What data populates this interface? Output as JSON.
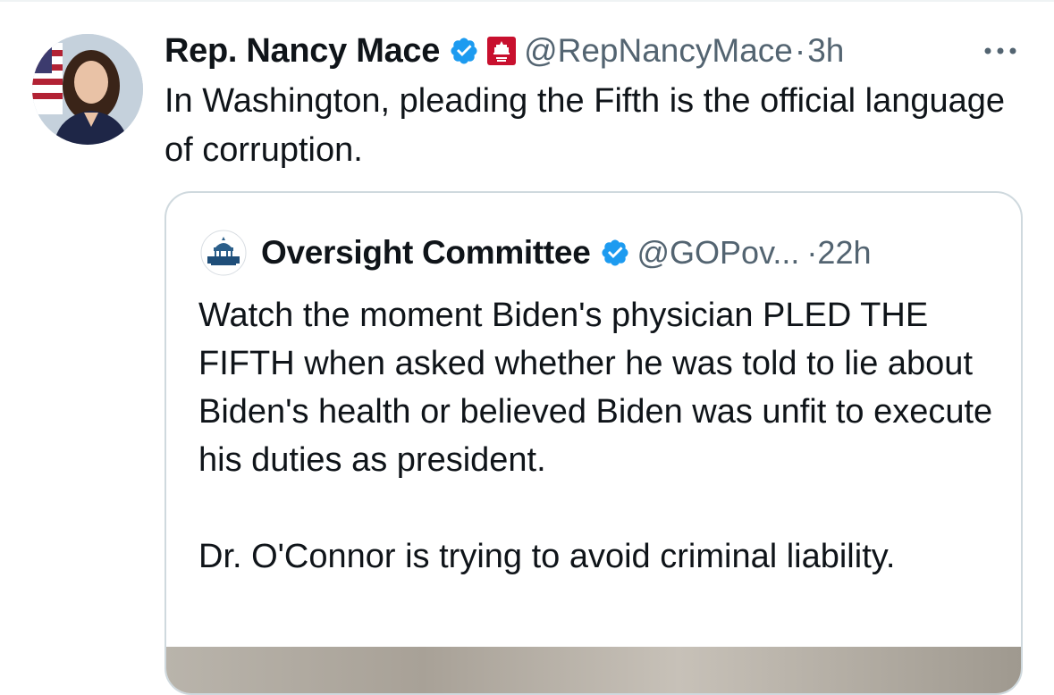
{
  "tweet": {
    "author_name": "Rep. Nancy Mace",
    "handle": "@RepNancyMace",
    "separator": "·",
    "time": "3h",
    "text": "In Washington, pleading the Fifth is the official language of corruption.",
    "verified_icon": "verified-badge-icon",
    "affiliation_icon": "house-gop-badge-icon",
    "more_icon": "more-horizontal-icon"
  },
  "quote": {
    "author_name": "Oversight Committee",
    "handle": "@GOPov...",
    "separator": "·",
    "time": "22h",
    "paragraph_1": "Watch the moment Biden's physician PLED THE FIFTH when asked whether he was told to lie about Biden's health or believed Biden was unfit to execute his duties as president.",
    "paragraph_2": "Dr. O'Connor is trying to avoid criminal liability.",
    "verified_icon": "verified-badge-icon"
  },
  "colors": {
    "text_primary": "#0f1419",
    "text_secondary": "#536471",
    "verified_blue": "#1d9bf0",
    "gop_red": "#c8102e",
    "border": "#cfd9de"
  }
}
